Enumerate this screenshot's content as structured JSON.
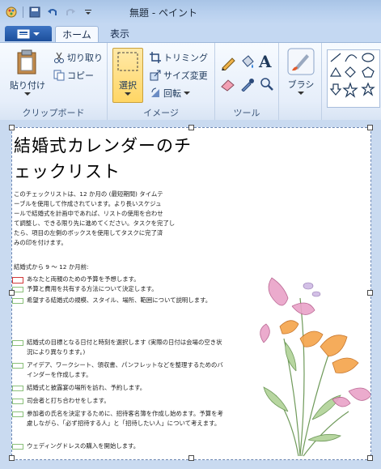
{
  "window": {
    "title": "無題 - ペイント"
  },
  "tabs": {
    "file_label": "",
    "home": "ホーム",
    "view": "表示"
  },
  "ribbon": {
    "clipboard": {
      "paste": "貼り付け",
      "cut": "切り取り",
      "copy": "コピー",
      "group_label": "クリップボード"
    },
    "image": {
      "select": "選択",
      "crop": "トリミング",
      "resize": "サイズ変更",
      "rotate": "回転",
      "group_label": "イメージ"
    },
    "tools": {
      "group_label": "ツール",
      "text_tool": "A"
    },
    "brush": {
      "label": "ブラシ"
    }
  },
  "document": {
    "title_line1": "結婚式カレンダーのチ",
    "title_line2": "ェックリスト",
    "intro": [
      "このチェックリストは、12 か月の (最短期間) タイムテ",
      "ーブルを使用して作成されています。より長いスケジュ",
      "ールで結婚式を計画中であれば、リストの使用を合わせ",
      "て調整し、できる限り先に進めてください。タスクを完了し",
      "たら、項目の左側のボックスを使用してタスクに完了済",
      "みの印を付けます。"
    ],
    "section_heading": "結婚式から 9 ～ 12 か月前:",
    "items": [
      {
        "text": "あなたと両親のための予算を予想します。",
        "color": "#d23a3a"
      },
      {
        "text": "予算と費用を共有する方法について決定します。",
        "color": "#8bc07a"
      },
      {
        "text": "希望する結婚式の規模、スタイル、場所、範囲について説明します。",
        "color": "#8bc07a"
      },
      {
        "text": "結婚式の目標となる日付と時刻を選択します (実際の日付は会場の空き状況により異なります。)",
        "color": "#8bc07a"
      },
      {
        "text": "アイデア、ワークシート、領収書、パンフレットなどを整理するためのバインダーを作成します。",
        "color": "#8bc07a"
      },
      {
        "text": "結婚式と披露宴の場所を訪れ、予約します。",
        "color": "#8bc07a"
      },
      {
        "text": "司会者と打ち合わせをします。",
        "color": "#8bc07a"
      },
      {
        "text": "参加者の氏名を決定するために、招待客名簿を作成し始めます。予算を考慮しながら、「必ず招待する人」と「招待したい人」について考えます。",
        "color": "#8bc07a"
      },
      {
        "text": "ウェディングドレスの購入を開始します。",
        "color": "#8bc07a"
      }
    ]
  },
  "colors": {
    "accent": "#1d4f9c",
    "select_highlight": "#ffd665",
    "checkbox_green": "#8bc07a",
    "checkbox_red": "#d23a3a"
  }
}
